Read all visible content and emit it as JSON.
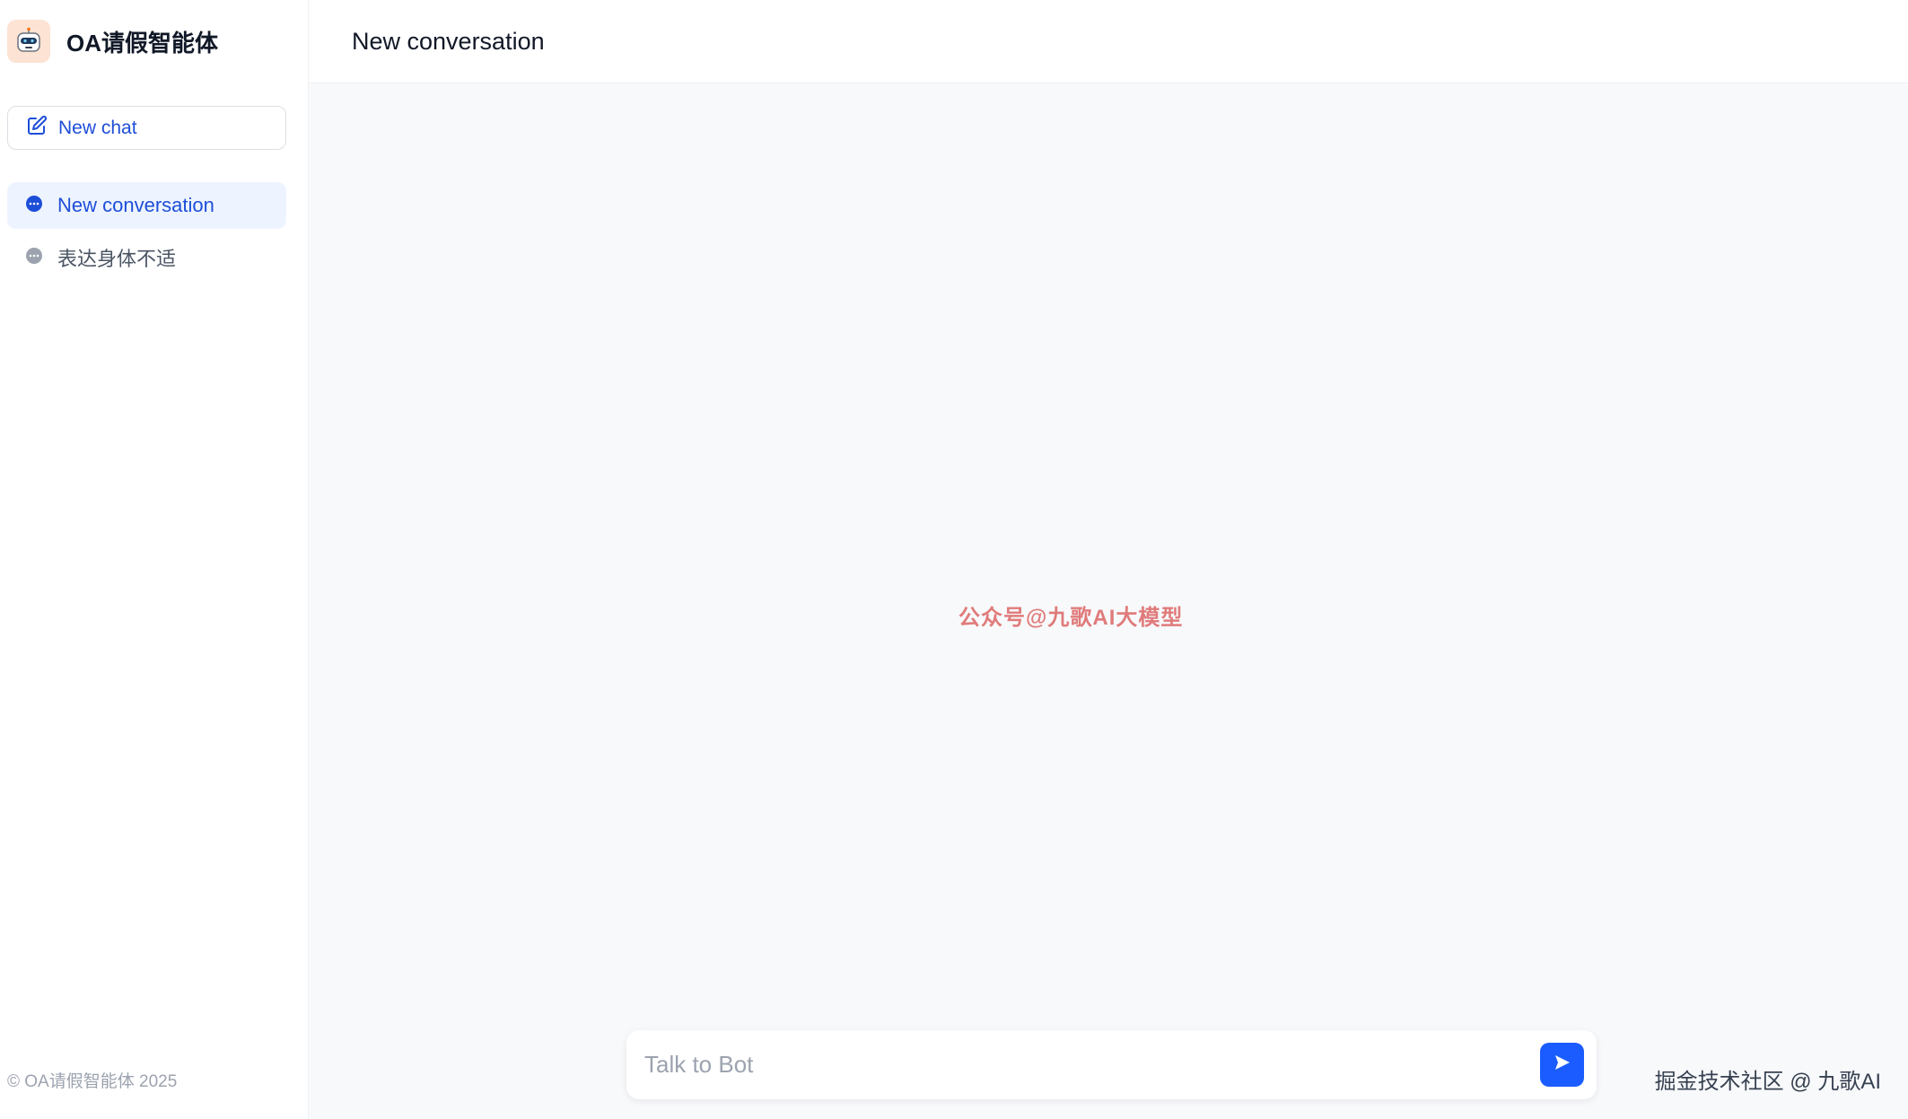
{
  "brand": {
    "title": "OA请假智能体"
  },
  "sidebar": {
    "new_chat_label": "New chat",
    "conversations": [
      {
        "label": "New conversation",
        "active": true
      },
      {
        "label": "表达身体不适",
        "active": false
      }
    ],
    "footer": "© OA请假智能体 2025"
  },
  "header": {
    "title": "New conversation"
  },
  "main": {
    "watermark": "公众号@九歌AI大模型"
  },
  "composer": {
    "placeholder": "Talk to Bot"
  },
  "overlay": {
    "credit": "掘金技术社区 @ 九歌AI"
  },
  "colors": {
    "accent": "#1a5cff",
    "active_bg": "#eef4ff",
    "watermark": "#e07b7b"
  },
  "icons": {
    "brand": "robot-icon",
    "new_chat": "edit-icon",
    "conversation": "chat-bubble-icon",
    "send": "send-icon"
  }
}
